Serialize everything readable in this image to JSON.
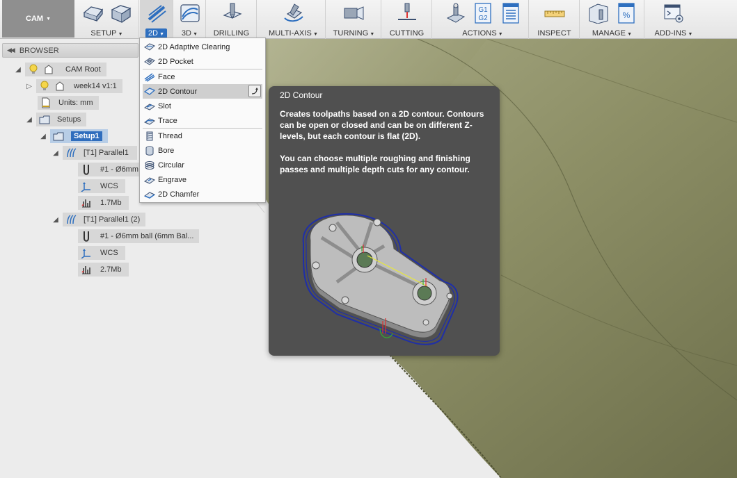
{
  "toolbar": {
    "workspace": "CAM",
    "groups": [
      {
        "key": "setup",
        "label": "SETUP",
        "caret": true
      },
      {
        "key": "2d",
        "label": "2D",
        "caret": true,
        "active": true
      },
      {
        "key": "3d",
        "label": "3D",
        "caret": true
      },
      {
        "key": "drilling",
        "label": "DRILLING",
        "caret": false
      },
      {
        "key": "multiaxis",
        "label": "MULTI-AXIS",
        "caret": true
      },
      {
        "key": "turning",
        "label": "TURNING",
        "caret": true
      },
      {
        "key": "cutting",
        "label": "CUTTING",
        "caret": false
      },
      {
        "key": "actions",
        "label": "ACTIONS",
        "caret": true
      },
      {
        "key": "inspect",
        "label": "INSPECT",
        "caret": false
      },
      {
        "key": "manage",
        "label": "MANAGE",
        "caret": true
      },
      {
        "key": "addins",
        "label": "ADD-INS",
        "caret": true
      }
    ],
    "gcode_icon_text": [
      "G1",
      "G2"
    ],
    "percent_icon_text": "%"
  },
  "browser": {
    "title": "BROWSER",
    "tree": {
      "cam_root": "CAM Root",
      "model": "week14 v1:1",
      "units": "Units: mm",
      "setups": "Setups",
      "setup1": "Setup1",
      "op1": {
        "name": "[T1] Parallel1",
        "tool": "#1 - Ø6mm",
        "wcs": "WCS",
        "size": "1.7Mb"
      },
      "op2": {
        "name": "[T1] Parallel1 (2)",
        "tool": "#1 - Ø6mm ball (6mm Bal...",
        "wcs": "WCS",
        "size": "2.7Mb"
      }
    }
  },
  "dropdown": {
    "items": [
      {
        "label": "2D Adaptive Clearing",
        "icon": "adaptive-clearing-icon"
      },
      {
        "label": "2D Pocket",
        "icon": "pocket-icon"
      },
      {
        "sep": true
      },
      {
        "label": "Face",
        "icon": "face-icon"
      },
      {
        "label": "2D Contour",
        "icon": "contour-icon",
        "hover": true
      },
      {
        "label": "Slot",
        "icon": "slot-icon"
      },
      {
        "label": "Trace",
        "icon": "trace-icon"
      },
      {
        "sep": true
      },
      {
        "label": "Thread",
        "icon": "thread-icon"
      },
      {
        "label": "Bore",
        "icon": "bore-icon"
      },
      {
        "label": "Circular",
        "icon": "circular-icon"
      },
      {
        "label": "Engrave",
        "icon": "engrave-icon"
      },
      {
        "label": "2D Chamfer",
        "icon": "chamfer-icon"
      }
    ]
  },
  "tooltip": {
    "title": "2D Contour",
    "paragraph1": "Creates toolpaths based on a 2D contour. Contours can be open or closed and can be on different Z-levels, but each contour is flat (2D).",
    "paragraph2": "You can choose multiple roughing and finishing passes and multiple depth cuts for any contour."
  },
  "colors": {
    "accent_blue": "#2f6dbd",
    "tooltip_bg": "#505050",
    "model_olive": "#8f9168",
    "toolpath_blue": "#1f2fa8"
  }
}
